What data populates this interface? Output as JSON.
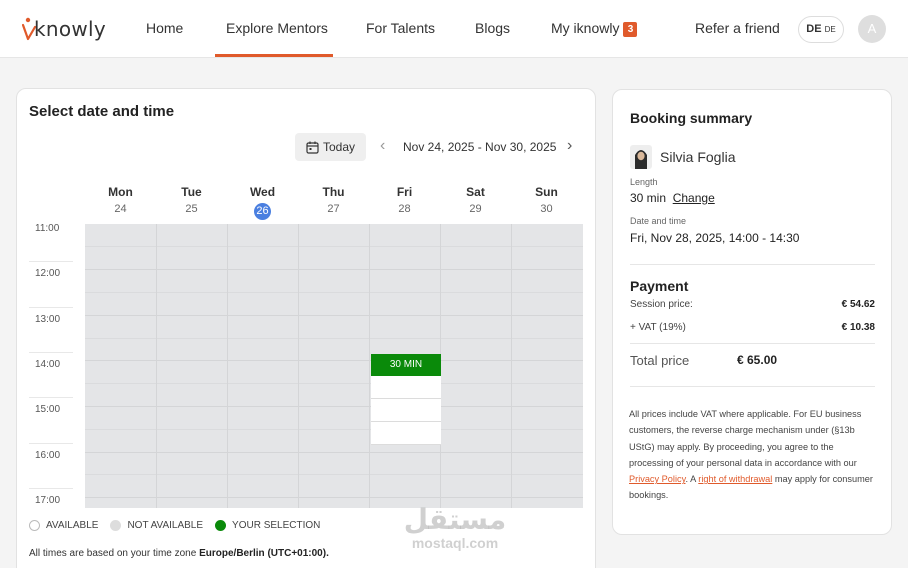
{
  "nav": {
    "logo_text": "knowly",
    "items": [
      {
        "label": "Home"
      },
      {
        "label": "Explore Mentors"
      },
      {
        "label": "For Talents"
      },
      {
        "label": "Blogs"
      },
      {
        "label": "My iknowly"
      },
      {
        "label": "Refer a friend"
      }
    ],
    "active_item": "Explore Mentors",
    "badge_count": "3",
    "lang_main": "DE",
    "lang_sub": "DE",
    "avatar_initial": "A"
  },
  "scheduler": {
    "title": "Select date and time",
    "today_label": "Today",
    "date_range": "Nov 24, 2025 - Nov 30, 2025",
    "days": [
      {
        "name": "Mon",
        "date": "24"
      },
      {
        "name": "Tue",
        "date": "25"
      },
      {
        "name": "Wed",
        "date": "26"
      },
      {
        "name": "Thu",
        "date": "27"
      },
      {
        "name": "Fri",
        "date": "28"
      },
      {
        "name": "Sat",
        "date": "29"
      },
      {
        "name": "Sun",
        "date": "30"
      }
    ],
    "current_day": "Wed",
    "times": [
      "11:00",
      "12:00",
      "13:00",
      "14:00",
      "15:00",
      "16:00",
      "17:00"
    ],
    "selection_label": "30 MIN",
    "legend": {
      "available": "AVAILABLE",
      "not_available": "NOT AVAILABLE",
      "your_selection": "YOUR SELECTION"
    },
    "tz_prefix": "All times are based on your time zone",
    "tz_value": "Europe/Berlin (UTC+01:00).",
    "colors": {
      "selection": "#0a8a0a",
      "unavailable": "#e4e5e7",
      "available": "#ffffff",
      "today": "#4a7fe0"
    }
  },
  "summary": {
    "title": "Booking summary",
    "mentor_name": "Silvia Foglia",
    "length_label": "Length",
    "length_value": "30 min",
    "change_link": "Change",
    "datetime_label": "Date and time",
    "datetime_value": "Fri, Nov 28, 2025, 14:00 - 14:30",
    "payment_title": "Payment",
    "session_price_label": "Session price:",
    "session_price_value": "€ 54.62",
    "vat_label": "+ VAT (19%)",
    "vat_value": "€ 10.38",
    "total_label": "Total price",
    "total_value": "€ 65.00",
    "note_part1": "All prices include VAT where applicable. For EU business customers, the reverse charge mechanism under (§13b UStG) may apply. By proceeding, you agree to the processing of your personal data in accordance with our",
    "privacy_link": "Privacy Policy",
    "note_part2": ". A",
    "withdrawal_link": "right of withdrawal",
    "note_part3": "may apply for consumer bookings."
  },
  "watermark": {
    "arabic": "مستقل",
    "latin": "mostaql.com"
  },
  "accent_color": "#e05a2b"
}
